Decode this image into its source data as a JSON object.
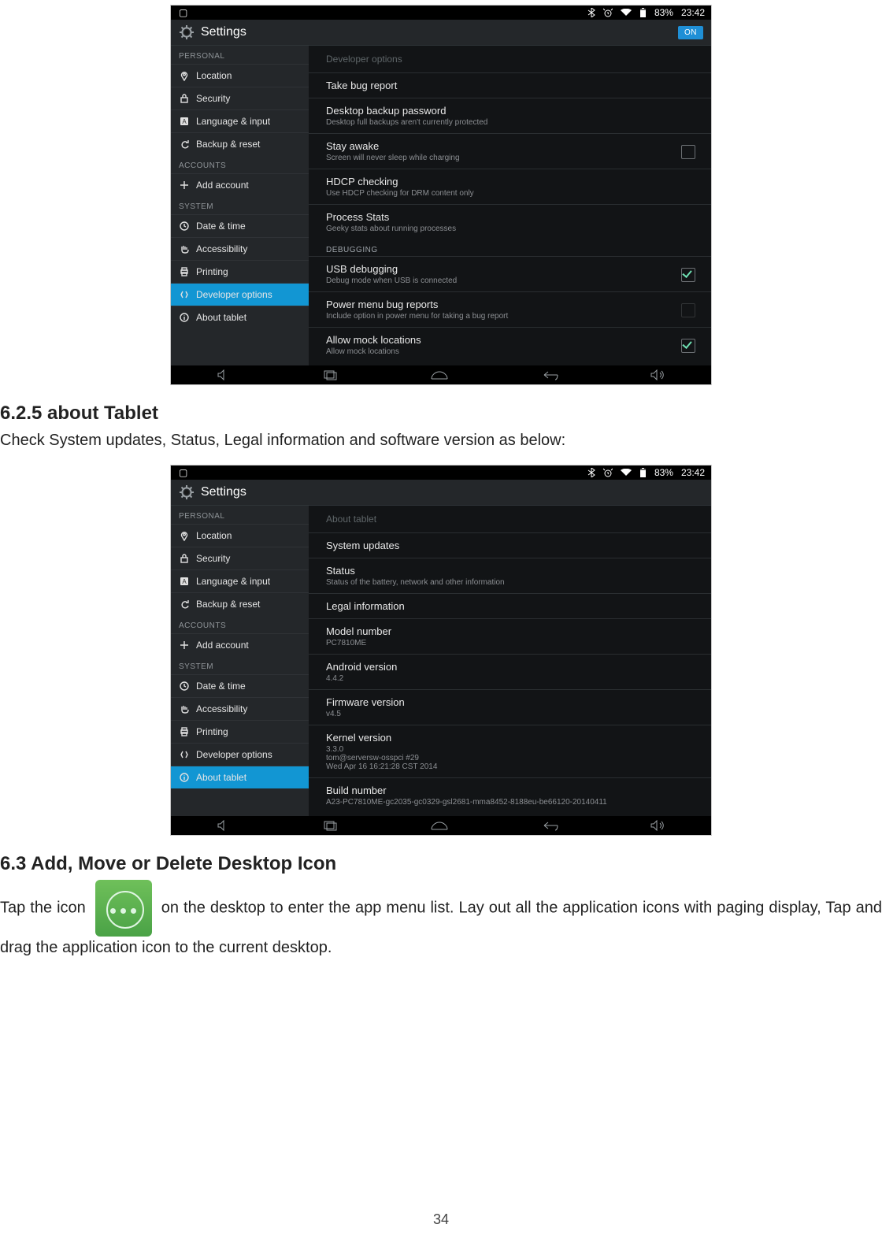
{
  "page_number": "34",
  "section625": {
    "heading": "6.2.5 about Tablet",
    "text": "Check System updates, Status, Legal information and software version as below:"
  },
  "section63": {
    "heading": "6.3 Add, Move or Delete Desktop Icon",
    "text1": "Tap the icon ",
    "text2": " on the desktop to enter the app menu list.    Lay out all the application icons with paging display, Tap and drag the application icon to the current desktop."
  },
  "shot1": {
    "status": {
      "battery": "83%",
      "time": "23:42"
    },
    "title": "Settings",
    "on_label": "ON",
    "sidebar": {
      "hdr_personal": "PERSONAL",
      "hdr_accounts": "ACCOUNTS",
      "hdr_system": "SYSTEM",
      "items": [
        {
          "label": "Location",
          "icon": "pin"
        },
        {
          "label": "Security",
          "icon": "lock"
        },
        {
          "label": "Language & input",
          "icon": "lang"
        },
        {
          "label": "Backup & reset",
          "icon": "backup"
        },
        {
          "label": "Add account",
          "icon": "plus"
        },
        {
          "label": "Date & time",
          "icon": "clock"
        },
        {
          "label": "Accessibility",
          "icon": "hand"
        },
        {
          "label": "Printing",
          "icon": "print"
        },
        {
          "label": "Developer options",
          "icon": "devops"
        },
        {
          "label": "About tablet",
          "icon": "info"
        }
      ],
      "active": "Developer options"
    },
    "panel_header": "Developer options",
    "rows": [
      {
        "t": "Take bug report"
      },
      {
        "t": "Desktop backup password",
        "s": "Desktop full backups aren't currently protected"
      },
      {
        "t": "Stay awake",
        "s": "Screen will never sleep while charging",
        "chk": "off"
      },
      {
        "t": "HDCP checking",
        "s": "Use HDCP checking for DRM content only"
      },
      {
        "t": "Process Stats",
        "s": "Geeky stats about running processes"
      }
    ],
    "grp_debugging": "DEBUGGING",
    "rows2": [
      {
        "t": "USB debugging",
        "s": "Debug mode when USB is connected",
        "chk": "on"
      },
      {
        "t": "Power menu bug reports",
        "s": "Include option in power menu for taking a bug report",
        "chk": "dim"
      },
      {
        "t": "Allow mock locations",
        "s": "Allow mock locations",
        "chk": "on"
      }
    ]
  },
  "shot2": {
    "status": {
      "battery": "83%",
      "time": "23:42"
    },
    "title": "Settings",
    "sidebar": {
      "hdr_personal": "PERSONAL",
      "hdr_accounts": "ACCOUNTS",
      "hdr_system": "SYSTEM",
      "items": [
        {
          "label": "Location",
          "icon": "pin"
        },
        {
          "label": "Security",
          "icon": "lock"
        },
        {
          "label": "Language & input",
          "icon": "lang"
        },
        {
          "label": "Backup & reset",
          "icon": "backup"
        },
        {
          "label": "Add account",
          "icon": "plus"
        },
        {
          "label": "Date & time",
          "icon": "clock"
        },
        {
          "label": "Accessibility",
          "icon": "hand"
        },
        {
          "label": "Printing",
          "icon": "print"
        },
        {
          "label": "Developer options",
          "icon": "devops"
        },
        {
          "label": "About tablet",
          "icon": "info"
        }
      ],
      "active": "About tablet"
    },
    "panel_header": "About tablet",
    "rows": [
      {
        "t": "System updates"
      },
      {
        "t": "Status",
        "s": "Status of the battery, network and other information"
      },
      {
        "t": "Legal information"
      },
      {
        "t": "Model number",
        "s": "PC7810ME"
      },
      {
        "t": "Android version",
        "s": "4.4.2"
      },
      {
        "t": "Firmware version",
        "s": "v4.5"
      },
      {
        "t": "Kernel version",
        "s": "3.3.0\ntom@serversw-osspci #29\nWed Apr 16 16:21:28 CST 2014"
      },
      {
        "t": "Build number",
        "s": "A23-PC7810ME-gc2035-gc0329-gsl2681-mma8452-8188eu-be66120-20140411"
      }
    ]
  }
}
